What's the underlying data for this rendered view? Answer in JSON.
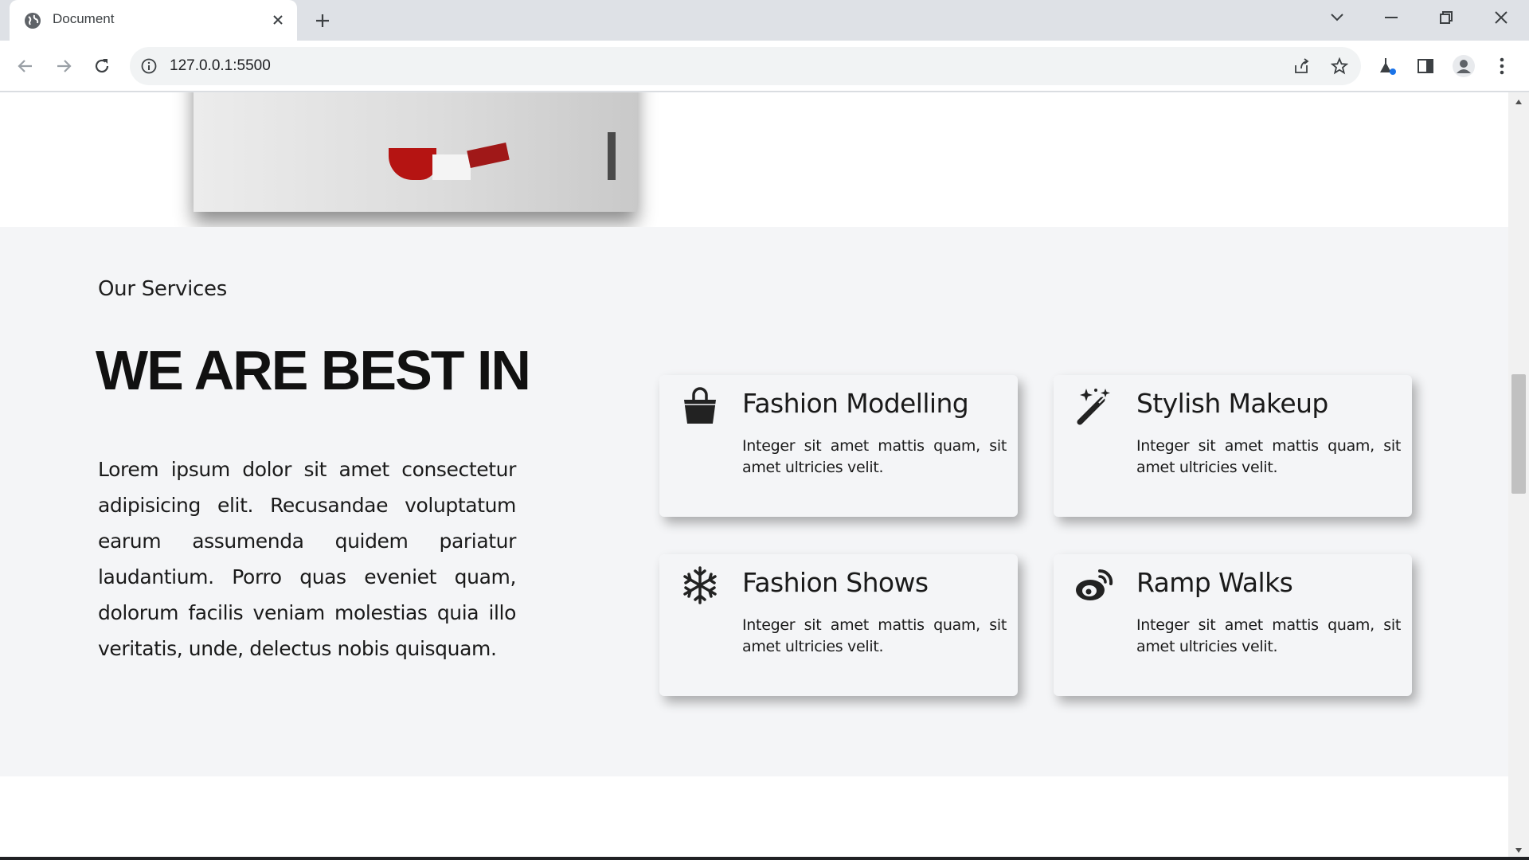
{
  "browser": {
    "tab_title": "Document",
    "url": "127.0.0.1:5500"
  },
  "services": {
    "subtitle": "Our Services",
    "title": "WE ARE BEST IN",
    "description": "Lorem ipsum dolor sit amet consectetur adipisicing elit. Recusandae voluptatum earum assumenda quidem pariatur laudantium. Porro quas eveniet quam, dolorum facilis veniam molestias quia illo veritatis, unde, delectus nobis quisquam.",
    "cards": [
      {
        "icon": "shopping-bag-icon",
        "title": "Fashion Modelling",
        "text": "Integer sit amet mattis quam, sit amet ultricies velit."
      },
      {
        "icon": "magic-wand-icon",
        "title": "Stylish Makeup",
        "text": "Integer sit amet mattis quam, sit amet ultricies velit."
      },
      {
        "icon": "snowflake-icon",
        "title": "Fashion Shows",
        "text": "Integer sit amet mattis quam, sit amet ultricies velit."
      },
      {
        "icon": "weibo-icon",
        "title": "Ramp Walks",
        "text": "Integer sit amet mattis quam, sit amet ultricies velit."
      }
    ]
  },
  "colors": {
    "section_bg": "#f4f5f7",
    "text": "#1a1a1a",
    "chrome_bg": "#dee1e6"
  }
}
